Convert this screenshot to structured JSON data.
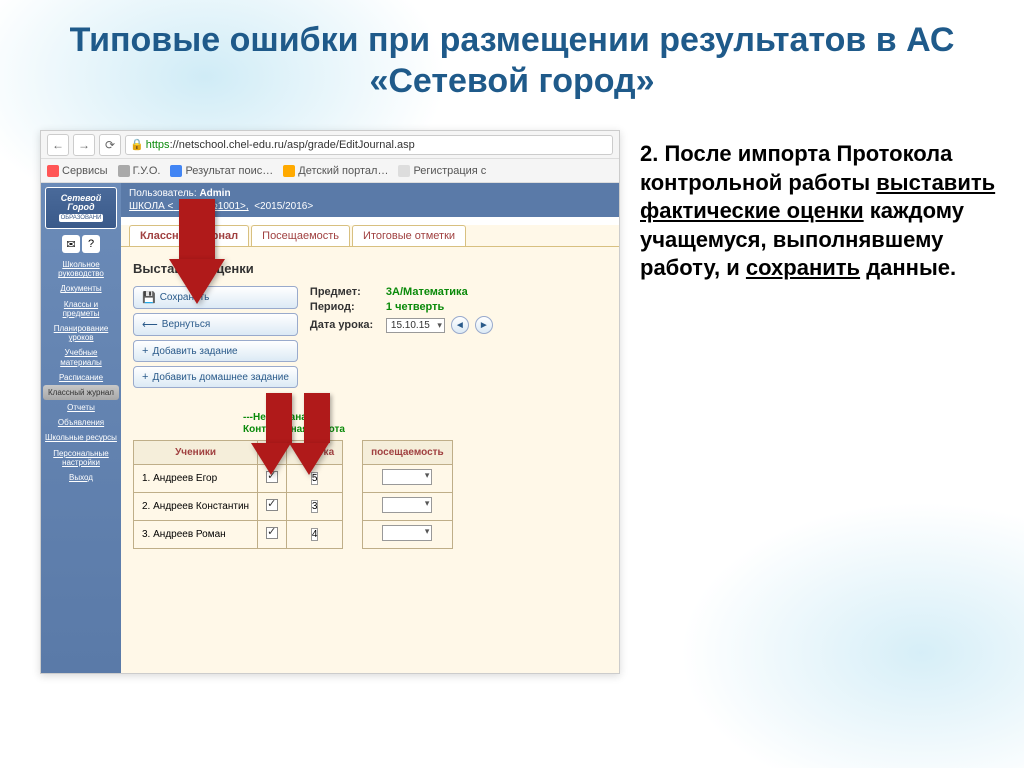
{
  "slide": {
    "title": "Типовые ошибки при размещении результатов в АС «Сетевой город»"
  },
  "browser": {
    "url_https": "https",
    "url_rest": "://netschool.chel-edu.ru/asp/grade/EditJournal.asp",
    "bookmarks": [
      "Сервисы",
      "Г.У.О.",
      "Результат поис…",
      "Детский портал…",
      "Регистрация с"
    ]
  },
  "app": {
    "logo_line1": "Сетевой",
    "logo_line2": "Город",
    "logo_sub": "ОБРАЗОВАНИ",
    "user_label": "Пользователь:",
    "user_name": "Admin",
    "school_prefix": "ШКОЛА <",
    "school_mid": "ОШ №1001",
    "school_suffix": ">,",
    "year": "<2015/2016>",
    "side": [
      "Школьное руководство",
      "Документы",
      "Классы и предметы",
      "Планирование уроков",
      "Учебные материалы",
      "Расписание",
      "Классный журнал",
      "Отчеты",
      "Объявления",
      "Школьные ресурсы",
      "Персональные настройки",
      "Выход"
    ],
    "tabs": [
      "Классный журнал",
      "Посещаемость",
      "Итоговые отметки"
    ],
    "page_title": "Выставить оценки",
    "buttons": {
      "save": "Сохранить",
      "back": "Вернуться",
      "add_task": "Добавить задание",
      "add_hw": "Добавить домашнее задание"
    },
    "info": {
      "subject_label": "Предмет:",
      "subject_val": "3А/Математика",
      "period_label": "Период:",
      "period_val": "1 четверть",
      "date_label": "Дата урока:",
      "date_val": "15.10.15"
    },
    "task_text1": "---Не указана---",
    "task_text2": "Контрольная работа",
    "table": {
      "h_students": "Ученики",
      "h_mark": "отметка",
      "h_attendance": "посещаемость",
      "rows": [
        {
          "n": "1.",
          "name": "Андреев Егор",
          "grade": "5"
        },
        {
          "n": "2.",
          "name": "Андреев Константин",
          "grade": "3"
        },
        {
          "n": "3.",
          "name": "Андреев Роман",
          "grade": "4"
        }
      ]
    }
  },
  "note": {
    "n": "2.",
    "t1": "После импорта Протокола контрольной работы ",
    "u1": "выставить фактические оценки",
    "t2": " каждому учащемуся, выполнявшему работу, и ",
    "u2": "сохранить",
    "t3": " данные."
  }
}
